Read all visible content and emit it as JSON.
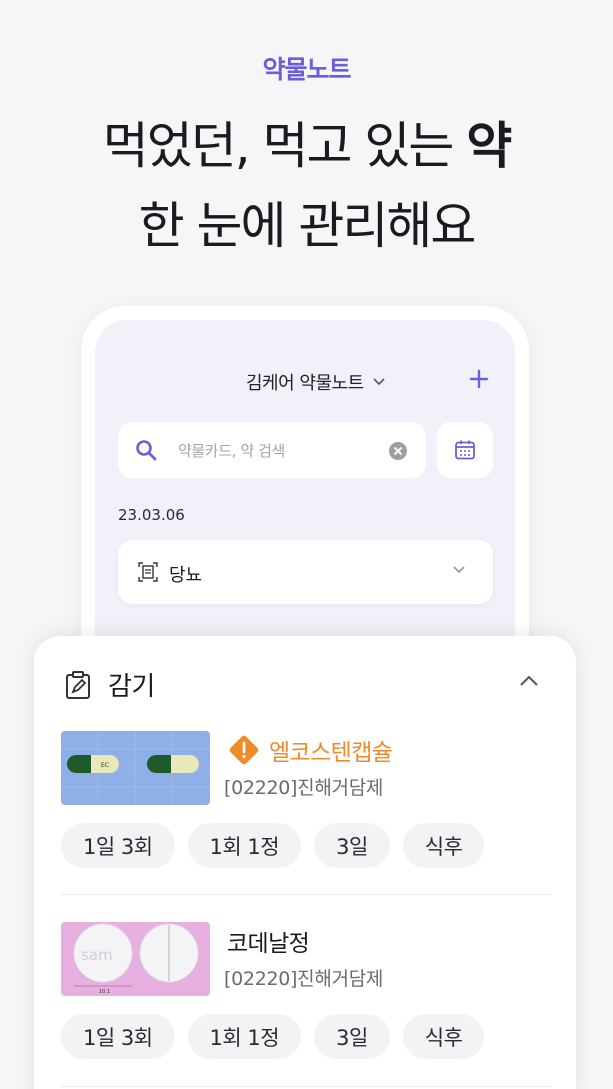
{
  "promo": {
    "brand": "약물노트",
    "headline_line1_prefix": "먹었던, 먹고 있는 ",
    "headline_line1_bold": "약",
    "headline_line2": "한 눈에 관리해요"
  },
  "phone": {
    "title": "김케어 약물노트",
    "search": {
      "placeholder": "약물카드, 약 검색"
    },
    "date": "23.03.06",
    "note_card": {
      "label": "당뇨"
    }
  },
  "sheet": {
    "title": "감기",
    "drugs": [
      {
        "name": "엘코스텐캡슐",
        "warning": true,
        "code": "[02220]진해거담제",
        "capsule_print": "EC",
        "chips": [
          "1일 3회",
          "1회 1정",
          "3일",
          "식후"
        ]
      },
      {
        "name": "코데날정",
        "warning": false,
        "code": "[02220]진해거담제",
        "tablet_print": "sam",
        "tablet_size": "10.1",
        "chips": [
          "1일 3회",
          "1회 1정",
          "3일",
          "식후"
        ]
      }
    ]
  },
  "colors": {
    "accent": "#6b5fd9",
    "warning": "#f08a2b",
    "capsule_bg": "#8fb0e6",
    "tablet_bg": "#e7aee0"
  },
  "icons": [
    "search-icon",
    "clear-icon",
    "calendar-icon",
    "plus-icon",
    "chevron-down-icon",
    "document-icon",
    "edit-clipboard-icon",
    "chevron-up-icon",
    "warning-diamond-icon"
  ]
}
